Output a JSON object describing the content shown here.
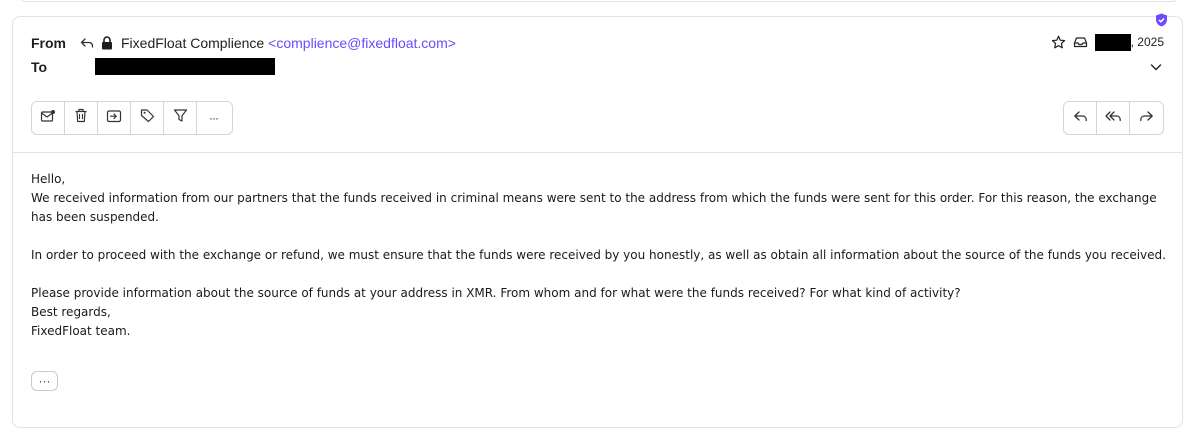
{
  "header": {
    "from_label": "From",
    "to_label": "To",
    "sender_name": "FixedFloat Complience",
    "sender_email": "<complience@fixedfloat.com>",
    "date_suffix": ", 2025"
  },
  "toolbar": {
    "buttons": [
      "move-to-inbox-icon",
      "trash-icon",
      "archive-icon",
      "label-icon",
      "filter-icon",
      "more-icon"
    ],
    "more_label": "···"
  },
  "reply_actions": [
    "reply-icon",
    "reply-all-icon",
    "forward-icon"
  ],
  "message": {
    "greeting": "Hello,",
    "p1": "We received information from our partners that the funds received in criminal means were sent to the address from which the funds were sent for this order. For this reason, the exchange has been suspended.",
    "p2": "In order to proceed with the exchange or refund, we must ensure that the funds were received by you honestly, as well as obtain all information about the source of the funds you received.",
    "p3": "Please provide information about the source of funds at your address in XMR. From whom and for what were the funds received? For what kind of activity?",
    "closing": "Best regards,",
    "signature": "FixedFloat team.",
    "show_more_label": "···"
  },
  "colors": {
    "accent": "#6d4aff",
    "border": "#e2e2e6",
    "redaction": "#000000"
  }
}
